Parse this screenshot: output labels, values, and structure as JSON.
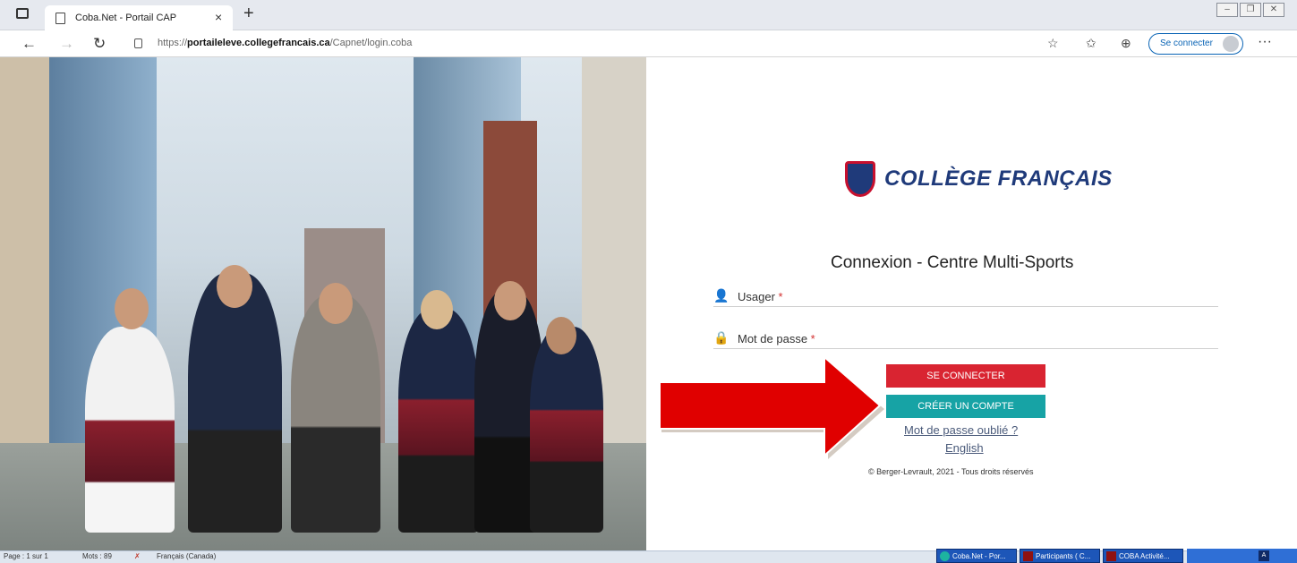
{
  "browser": {
    "tab_title": "Coba.Net - Portail CAP",
    "tab_close": "×",
    "new_tab": "+",
    "url_prefix": "https://",
    "url_domain": "portaileleve.collegefrancais.ca",
    "url_path": "/Capnet/login.coba",
    "signin_label": "Se connecter",
    "more_label": "···"
  },
  "page": {
    "logo_text": "COLLÈGE FRANÇAIS",
    "title": "Connexion - Centre Multi-Sports",
    "username_label": "Usager",
    "password_label": "Mot de passe",
    "required_mark": "*",
    "login_button": "SE CONNECTER",
    "create_account_button": "CRÉER UN COMPTE",
    "forgot_password_link": "Mot de passe oublié ?",
    "language_link": "English",
    "copyright": "© Berger-Levrault, 2021 - Tous droits réservés"
  },
  "statusbar": {
    "page": "Page : 1 sur 1",
    "words": "Mots : 89",
    "language": "Français (Canada)"
  },
  "taskbar": {
    "items": [
      "Coba.Net - Por...",
      "Participants ( C...",
      "COBA Activité..."
    ]
  },
  "colors": {
    "primary_red": "#d92431",
    "teal": "#17a3a5",
    "brand_navy": "#1f3a7a",
    "arrow_red": "#e00000"
  }
}
